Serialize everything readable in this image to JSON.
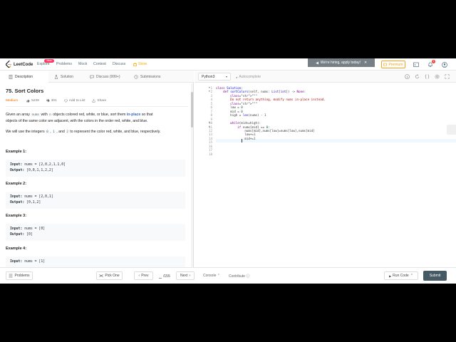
{
  "nav": {
    "logo_text": "LeetCode",
    "items": [
      "Explore",
      "Problems",
      "Mock",
      "Contest",
      "Discuss"
    ],
    "store": "Store",
    "new_badge": "New",
    "hiring": "We're hiring, apply today!",
    "premium": "Premium",
    "bell_count": "1",
    "colors": {
      "store": "#f8ac00",
      "premium": "#f3a21c",
      "badge": "#ff375f"
    }
  },
  "tabs": [
    {
      "label": "Description",
      "icon": "document-icon"
    },
    {
      "label": "Solution",
      "icon": "flask-icon"
    },
    {
      "label": "Discuss (999+)",
      "icon": "chat-icon"
    },
    {
      "label": "Submissions",
      "icon": "history-icon"
    }
  ],
  "problem": {
    "title": "75. Sort Colors",
    "difficulty": "Medium",
    "likes": "5239",
    "dislikes": "301",
    "add_to_list": "Add to List",
    "share": "Share",
    "desc1_a": "Given an array ",
    "desc1_code": "nums",
    "desc1_b": " with ",
    "desc1_n": "n",
    "desc1_c": " objects colored red, white, or blue, sort them ",
    "desc1_link": "in-place",
    "desc1_d": " so that",
    "desc1_line2": "objects of the same color are adjacent, with the colors in the order red, white, and blue.",
    "desc2_a": "We will use the integers ",
    "desc2_c0": "0",
    "desc2_sep1": " , ",
    "desc2_c1": "1",
    "desc2_sep2": " , and ",
    "desc2_c2": "2",
    "desc2_b": " to represent the color red, white, and blue, respectively.",
    "examples": [
      {
        "title": "Example 1:",
        "input": "nums = [2,0,2,1,1,0]",
        "output": "[0,0,1,1,2,2]"
      },
      {
        "title": "Example 2:",
        "input": "nums = [2,0,1]",
        "output": "[0,1,2]"
      },
      {
        "title": "Example 3:",
        "input": "nums = [0]",
        "output": "[0]"
      },
      {
        "title": "Example 4:",
        "input": "nums = [1]",
        "output": ""
      }
    ],
    "input_label": "Input:",
    "output_label": "Output:"
  },
  "editor": {
    "language": "Python3",
    "autocomplete": "Autocomplete",
    "line_numbers": [
      "1",
      "2",
      "3",
      "4",
      "5",
      "6",
      "7",
      "8",
      "9",
      "10",
      "11",
      "12",
      "13",
      "14",
      "15",
      "16",
      "17",
      "18"
    ],
    "code": [
      "class Solution:",
      "    def sortColors(self, nums: List[int]) -> None:",
      "        \"\"\"",
      "        Do not return anything, modify nums in-place instead.",
      "        \"\"\"",
      "        low = 0",
      "        mid = 0",
      "        high = len(nums) - 1",
      "",
      "        while(mid<=high):",
      "            if nums[mid] == 0:",
      "                nums[mid],nums[low]=nums[low],nums[mid]",
      "                low+=1",
      "                mid+=1",
      "",
      "",
      "",
      ""
    ]
  },
  "bottom": {
    "problems": "Problems",
    "pick_one": "Pick One",
    "prev": "Prev",
    "page": "/155",
    "next": "Next",
    "console": "Console",
    "contribute": "Contribute",
    "run_code": "Run Code",
    "submit": "Submit",
    "colors": {
      "submit": "#455a64"
    }
  }
}
